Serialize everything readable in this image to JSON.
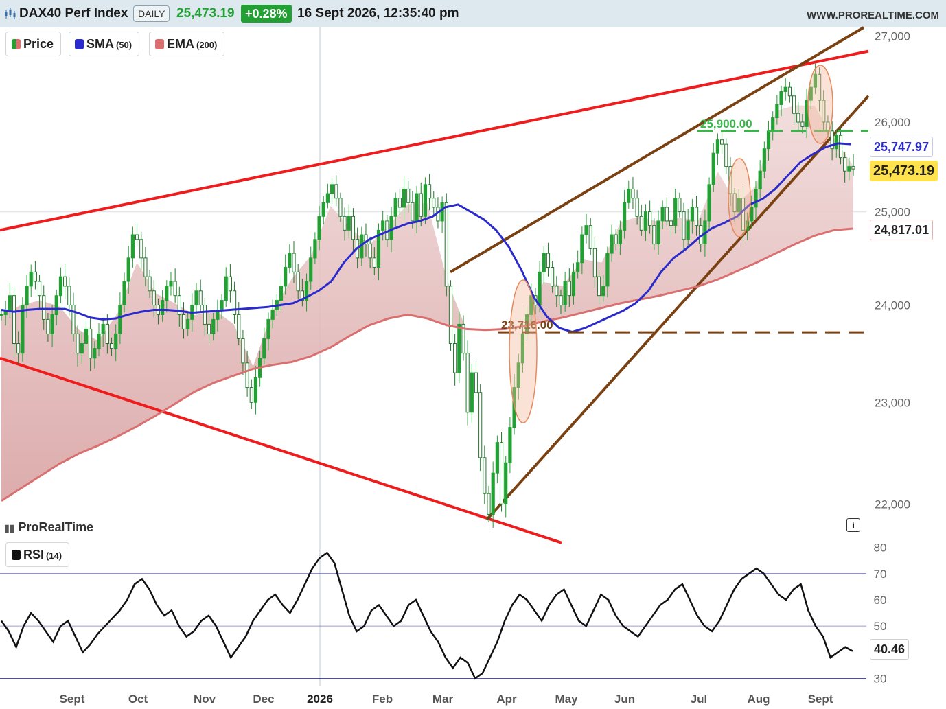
{
  "header": {
    "instrument": "DAX40 Perf Index",
    "timeframe": "DAILY",
    "last_price": "25,473.19",
    "change": "+0.28%",
    "datetime": "16 Sept 2026, 12:35:40 pm",
    "website": "WWW.PROREALTIME.COM"
  },
  "legend": {
    "price": "Price",
    "sma": "SMA",
    "sma_period": "(50)",
    "ema": "EMA",
    "ema_period": "(200)",
    "rsi": "RSI",
    "rsi_period": "(14)"
  },
  "branding": "ProRealTime",
  "info_icon": "i",
  "colors": {
    "up": "#22a034",
    "sma": "#2b2bcc",
    "ema": "#d9706f",
    "trend_red": "#ee1c1c",
    "trend_brown": "#7a4212",
    "level_green": "#39b54a",
    "highlight": "#f3b69c",
    "last_price_bg": "#ffe24d"
  },
  "chart_data": [
    {
      "type": "candlestick",
      "title": "DAX40 Perf Index",
      "ylim": [
        21700,
        27100
      ],
      "y_ticks": [
        "27,000",
        "26,000",
        "25,000",
        "24,000",
        "23,000",
        "22,000"
      ],
      "x_ticks": [
        "Sept",
        "Oct",
        "Nov",
        "Dec",
        "2026",
        "Feb",
        "Mar",
        "Apr",
        "May",
        "Jun",
        "Jul",
        "Aug",
        "Sept"
      ],
      "last_values": {
        "price": "25,473.19",
        "sma50": "25,747.97",
        "ema200": "24,817.01"
      },
      "level_labels": [
        "25,900.00",
        "23,716.00"
      ],
      "series": [
        {
          "name": "Price",
          "close": [
            23900,
            23950,
            24100,
            23600,
            23500,
            24000,
            24200,
            24350,
            24250,
            24100,
            23850,
            23700,
            23900,
            24100,
            24300,
            24200,
            24000,
            23700,
            23500,
            23600,
            23750,
            23450,
            23550,
            23700,
            23800,
            23600,
            23550,
            23700,
            24000,
            24250,
            24500,
            24750,
            24700,
            24500,
            24300,
            24150,
            24000,
            23900,
            24050,
            24200,
            24250,
            24100,
            23900,
            23750,
            23850,
            24000,
            24150,
            24000,
            23800,
            23700,
            23850,
            23950,
            24050,
            24300,
            24150,
            23900,
            23650,
            23400,
            23150,
            23000,
            23250,
            23450,
            23650,
            23850,
            23950,
            24050,
            24200,
            24400,
            24550,
            24350,
            24150,
            24050,
            24250,
            24500,
            24700,
            24950,
            25100,
            25200,
            25300,
            25150,
            24950,
            24800,
            24950,
            24700,
            24500,
            24750,
            24650,
            24500,
            24400,
            24800,
            24900,
            24700,
            24950,
            25150,
            25050,
            25250,
            25100,
            24900,
            25200,
            24950,
            25300,
            25150,
            25050,
            24900,
            25100,
            24200,
            23600,
            23300,
            23800,
            23500,
            22900,
            23300,
            23100,
            22450,
            22100,
            21900,
            22300,
            22600,
            22000,
            22400,
            22750,
            23150,
            23400,
            23700,
            23900,
            24100,
            24000,
            24350,
            24550,
            24400,
            24200,
            24100,
            24000,
            24250,
            24100,
            24350,
            24450,
            24750,
            24850,
            24600,
            24300,
            24100,
            24200,
            24550,
            24750,
            24650,
            24800,
            25100,
            25250,
            25150,
            24950,
            24800,
            25000,
            24850,
            24650,
            24900,
            25050,
            24900,
            24850,
            25150,
            25000,
            24700,
            24900,
            25050,
            24850,
            24650,
            24900,
            25300,
            25650,
            25800,
            25750,
            25500,
            25200,
            25000,
            25150,
            24800,
            24900,
            25050,
            25250,
            25450,
            25700,
            25900,
            26050,
            26200,
            26350,
            26400,
            26300,
            26100,
            26000,
            25950,
            26250,
            26400,
            26550,
            26250,
            26000,
            25900,
            25700,
            25850,
            25600,
            25450,
            25500,
            25473.19
          ]
        },
        {
          "name": "SMA",
          "values": [
            23950,
            23930,
            23950,
            23960,
            23960,
            23960,
            23920,
            23870,
            23850,
            23860,
            23900,
            23930,
            23950,
            23950,
            23940,
            23920,
            23930,
            23940,
            23950,
            23960,
            23970,
            23980,
            24000,
            24020,
            24080,
            24150,
            24250,
            24450,
            24600,
            24700,
            24760,
            24820,
            24870,
            24900,
            24950,
            25050,
            25080,
            25000,
            24920,
            24800,
            24620,
            24370,
            24080,
            23880,
            23760,
            23720,
            23760,
            23820,
            23880,
            23940,
            24020,
            24150,
            24350,
            24500,
            24600,
            24720,
            24820,
            24880,
            24950,
            25080,
            25140,
            25250,
            25400,
            25550,
            25640,
            25720,
            25760,
            25750
          ]
        },
        {
          "name": "EMA",
          "values": [
            22030,
            22150,
            22270,
            22390,
            22490,
            22570,
            22660,
            22760,
            22870,
            22990,
            23110,
            23200,
            23270,
            23340,
            23380,
            23410,
            23470,
            23560,
            23680,
            23790,
            23860,
            23900,
            23860,
            23790,
            23750,
            23740,
            23750,
            23780,
            23830,
            23870,
            23920,
            23970,
            24020,
            24060,
            24100,
            24150,
            24200,
            24270,
            24360,
            24450,
            24550,
            24650,
            24740,
            24800,
            24817
          ]
        }
      ],
      "trend_lines": [
        {
          "name": "upper resistance",
          "points": [
            [
              "Aug 2025",
              24800
            ],
            [
              "Sept 2026",
              26800
            ]
          ]
        },
        {
          "name": "lower support",
          "points": [
            [
              "Aug 2025",
              23450
            ],
            [
              "May 2026",
              21650
            ]
          ]
        },
        {
          "name": "channel top",
          "points": [
            [
              "Mar 2026",
              24350
            ],
            [
              "Sept 2026",
              27100
            ]
          ]
        },
        {
          "name": "channel bottom",
          "points": [
            [
              "Mar 2026",
              21850
            ],
            [
              "Sept 2026",
              26300
            ]
          ]
        }
      ],
      "levels": [
        {
          "label": "25,900.00",
          "value": 25900
        },
        {
          "label": "23,716.00",
          "value": 23716
        }
      ]
    },
    {
      "type": "line",
      "title": "RSI (14)",
      "ylim": [
        27,
        82
      ],
      "y_ticks": [
        "80",
        "70",
        "60",
        "50",
        "40",
        "30"
      ],
      "reference_lines": [
        30,
        50,
        70
      ],
      "last_value": "40.46",
      "series": [
        {
          "name": "RSI",
          "values": [
            52,
            48,
            42,
            50,
            55,
            52,
            48,
            44,
            50,
            52,
            46,
            40,
            43,
            47,
            50,
            53,
            56,
            60,
            66,
            68,
            64,
            58,
            54,
            56,
            50,
            46,
            48,
            52,
            54,
            50,
            44,
            38,
            42,
            46,
            52,
            56,
            60,
            62,
            58,
            55,
            60,
            66,
            72,
            76,
            78,
            74,
            64,
            54,
            48,
            50,
            56,
            58,
            54,
            50,
            52,
            58,
            60,
            54,
            48,
            44,
            38,
            34,
            38,
            36,
            30,
            32,
            38,
            44,
            52,
            58,
            62,
            60,
            56,
            52,
            58,
            62,
            64,
            58,
            52,
            50,
            56,
            62,
            60,
            54,
            50,
            48,
            46,
            50,
            54,
            58,
            60,
            64,
            66,
            60,
            54,
            50,
            48,
            52,
            58,
            64,
            68,
            70,
            72,
            70,
            66,
            62,
            60,
            64,
            66,
            56,
            50,
            46,
            38,
            40,
            42,
            40.46
          ]
        }
      ]
    }
  ]
}
